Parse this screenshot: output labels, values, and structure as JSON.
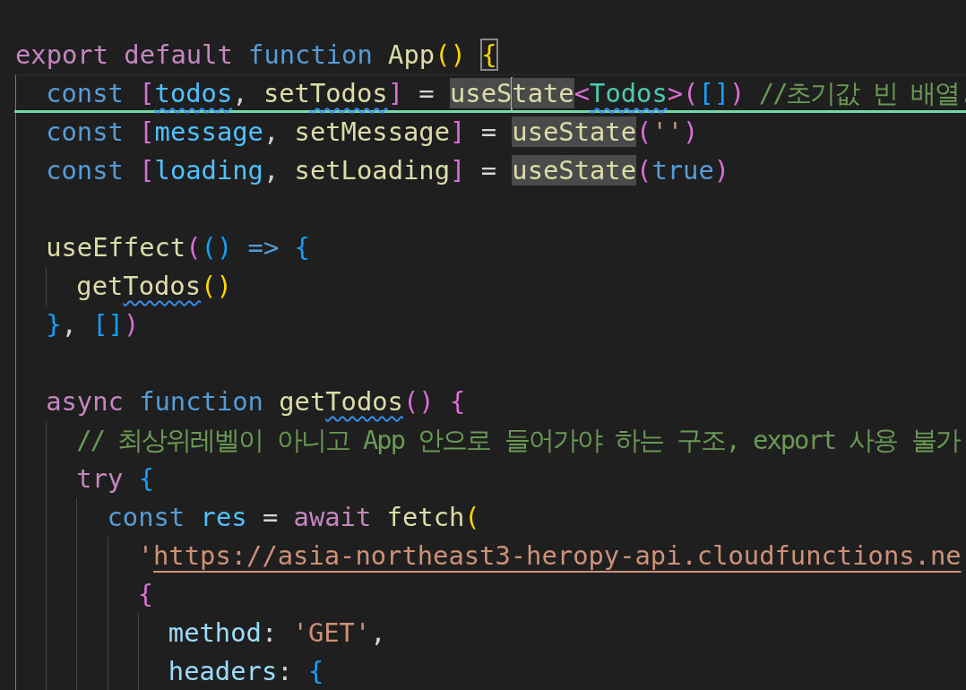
{
  "editor": {
    "lines": [
      {
        "kind": "code",
        "tokens": [
          {
            "kind": "control",
            "t": "export"
          },
          {
            "kind": "control",
            "t": " default"
          },
          {
            "kind": "keyword",
            "t": " function"
          },
          {
            "kind": "function",
            "t": " App"
          },
          {
            "kind": "bracket1",
            "t": "() "
          },
          {
            "kind": "bracket1",
            "t": "{",
            "matched": true
          }
        ],
        "children": [
          {
            "kind": "code",
            "current": true,
            "tokens": [
              {
                "kind": "keyword",
                "t": "const"
              },
              {
                "kind": "bracket2",
                "t": " ["
              },
              {
                "kind": "constant",
                "t": "todos",
                "squiggle": true
              },
              {
                "kind": "punct",
                "t": ","
              },
              {
                "kind": "function",
                "t": " set"
              },
              {
                "kind": "function",
                "t": "Todos",
                "squiggle": true
              },
              {
                "kind": "bracket2",
                "t": "]"
              },
              {
                "kind": "punct",
                "t": " = "
              },
              {
                "kind": "function",
                "t": "useS",
                "highlight": true,
                "caret": true
              },
              {
                "kind": "function",
                "t": "tate",
                "highlight": true
              },
              {
                "kind": "bracket2",
                "t": "<"
              },
              {
                "kind": "type",
                "t": "Todos",
                "squiggle": true
              },
              {
                "kind": "bracket2",
                "t": ">("
              },
              {
                "kind": "bracket3",
                "t": "[]"
              },
              {
                "kind": "bracket2",
                "t": ")"
              },
              {
                "kind": "comment",
                "t": " //초기값 빈 배열."
              }
            ]
          },
          {
            "kind": "code",
            "tokens": [
              {
                "kind": "keyword",
                "t": "const"
              },
              {
                "kind": "bracket2",
                "t": " ["
              },
              {
                "kind": "constant",
                "t": "message"
              },
              {
                "kind": "punct",
                "t": ","
              },
              {
                "kind": "function",
                "t": " setMessage"
              },
              {
                "kind": "bracket2",
                "t": "]"
              },
              {
                "kind": "punct",
                "t": " = "
              },
              {
                "kind": "function",
                "t": "useState",
                "highlight": true
              },
              {
                "kind": "bracket2",
                "t": "("
              },
              {
                "kind": "string",
                "t": "''"
              },
              {
                "kind": "bracket2",
                "t": ")"
              }
            ]
          },
          {
            "kind": "code",
            "tokens": [
              {
                "kind": "keyword",
                "t": "const"
              },
              {
                "kind": "bracket2",
                "t": " ["
              },
              {
                "kind": "constant",
                "t": "loading"
              },
              {
                "kind": "punct",
                "t": ","
              },
              {
                "kind": "function",
                "t": " setLoading"
              },
              {
                "kind": "bracket2",
                "t": "]"
              },
              {
                "kind": "punct",
                "t": " = "
              },
              {
                "kind": "function",
                "t": "useState",
                "highlight": true
              },
              {
                "kind": "bracket2",
                "t": "("
              },
              {
                "kind": "keyword",
                "t": "true"
              },
              {
                "kind": "bracket2",
                "t": ")"
              }
            ]
          },
          {
            "kind": "blank"
          },
          {
            "kind": "code",
            "tokens": [
              {
                "kind": "function",
                "t": "useEffect"
              },
              {
                "kind": "bracket2",
                "t": "("
              },
              {
                "kind": "bracket3",
                "t": "()"
              },
              {
                "kind": "keyword",
                "t": " =>"
              },
              {
                "kind": "bracket3",
                "t": " {"
              }
            ],
            "children": [
              {
                "kind": "code",
                "tokens": [
                  {
                    "kind": "function",
                    "t": "get"
                  },
                  {
                    "kind": "function",
                    "t": "Todos",
                    "squiggle": true
                  },
                  {
                    "kind": "bracket1",
                    "t": "()"
                  }
                ]
              }
            ]
          },
          {
            "kind": "code",
            "tokens": [
              {
                "kind": "bracket3",
                "t": "}"
              },
              {
                "kind": "punct",
                "t": ","
              },
              {
                "kind": "bracket3",
                "t": " []"
              },
              {
                "kind": "bracket2",
                "t": ")"
              }
            ]
          },
          {
            "kind": "blank"
          },
          {
            "kind": "code",
            "tokens": [
              {
                "kind": "control",
                "t": "async"
              },
              {
                "kind": "keyword",
                "t": " function"
              },
              {
                "kind": "function",
                "t": " get"
              },
              {
                "kind": "function",
                "t": "Todos",
                "squiggle": true
              },
              {
                "kind": "bracket2",
                "t": "()"
              },
              {
                "kind": "bracket2",
                "t": " {"
              }
            ],
            "children": [
              {
                "kind": "code",
                "tokens": [
                  {
                    "kind": "comment",
                    "t": "// 최상위레벨이 아니고 App 안으로 들어가야 하는 구조, export 사용 불가"
                  }
                ]
              },
              {
                "kind": "code",
                "tokens": [
                  {
                    "kind": "control",
                    "t": "try"
                  },
                  {
                    "kind": "bracket3",
                    "t": " {"
                  }
                ],
                "children": [
                  {
                    "kind": "code",
                    "tokens": [
                      {
                        "kind": "keyword",
                        "t": "const"
                      },
                      {
                        "kind": "constant",
                        "t": " res"
                      },
                      {
                        "kind": "punct",
                        "t": " ="
                      },
                      {
                        "kind": "control",
                        "t": " await"
                      },
                      {
                        "kind": "function",
                        "t": " fetch"
                      },
                      {
                        "kind": "bracket1",
                        "t": "("
                      }
                    ],
                    "children": [
                      {
                        "kind": "code",
                        "tokens": [
                          {
                            "kind": "string",
                            "t": "'"
                          },
                          {
                            "kind": "string",
                            "t": "https://asia-northeast3-heropy-api.cloudfunctions.ne",
                            "link": true
                          }
                        ]
                      },
                      {
                        "kind": "code",
                        "tokens": [
                          {
                            "kind": "bracket2",
                            "t": "{"
                          }
                        ],
                        "children": [
                          {
                            "kind": "code",
                            "tokens": [
                              {
                                "kind": "property",
                                "t": "method"
                              },
                              {
                                "kind": "punct",
                                "t": ":"
                              },
                              {
                                "kind": "string",
                                "t": " 'GET'"
                              },
                              {
                                "kind": "punct",
                                "t": ","
                              }
                            ]
                          },
                          {
                            "kind": "code",
                            "tokens": [
                              {
                                "kind": "property",
                                "t": "headers"
                              },
                              {
                                "kind": "punct",
                                "t": ":"
                              },
                              {
                                "kind": "bracket3",
                                "t": " {"
                              }
                            ]
                          }
                        ]
                      }
                    ]
                  }
                ]
              }
            ]
          }
        ]
      }
    ]
  }
}
